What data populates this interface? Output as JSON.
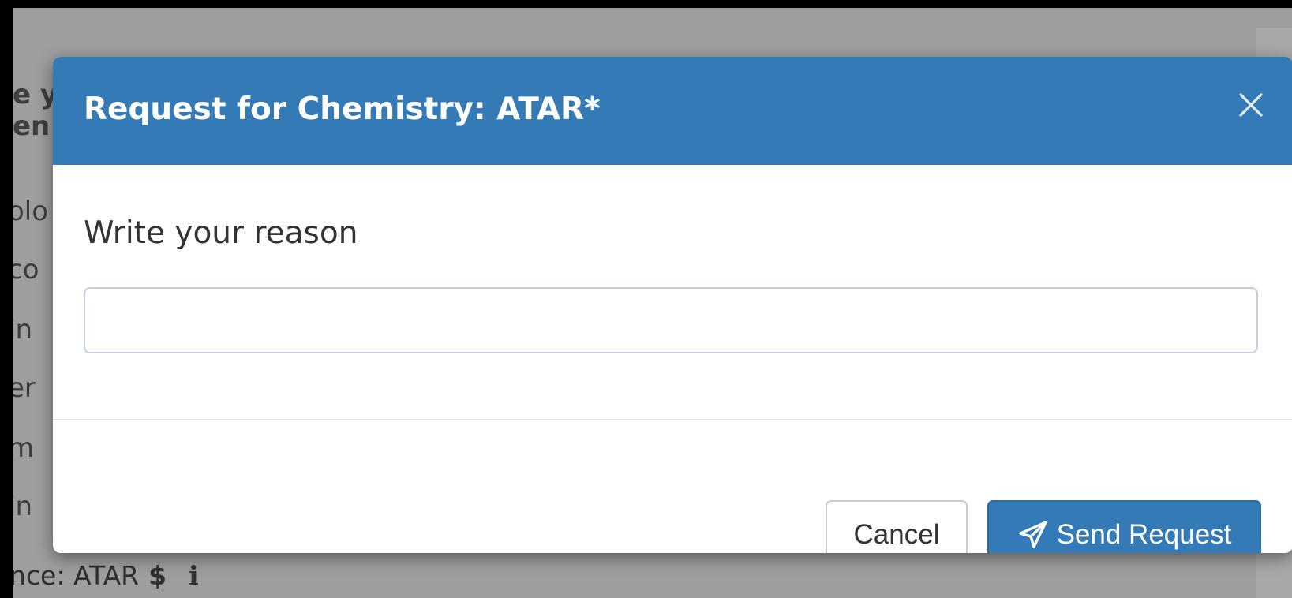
{
  "background": {
    "text_fragments": [
      {
        "text": "e y",
        "bold": true
      },
      {
        "text": "en",
        "bold": true
      },
      {
        "text": "olo",
        "bold": false
      },
      {
        "text": "co",
        "bold": false
      },
      {
        "text": "in",
        "bold": false
      },
      {
        "text": "er",
        "bold": false
      },
      {
        "text": "m",
        "bold": false
      },
      {
        "text": "in",
        "bold": false
      }
    ],
    "fee_line": {
      "text": "nce: ATAR",
      "dollar_icon": "dollar-icon",
      "info_icon": "info-icon"
    }
  },
  "modal": {
    "title": "Request for Chemistry: ATAR*",
    "close_icon": "close-icon",
    "field_label": "Write your reason",
    "reason_input": {
      "value": "",
      "placeholder": ""
    },
    "buttons": {
      "cancel": "Cancel",
      "send": "Send Request",
      "send_icon": "paper-plane-icon"
    }
  },
  "colors": {
    "header": "#337ab7",
    "primary_button": "#337ab7",
    "overlay": "#9e9e9e"
  }
}
